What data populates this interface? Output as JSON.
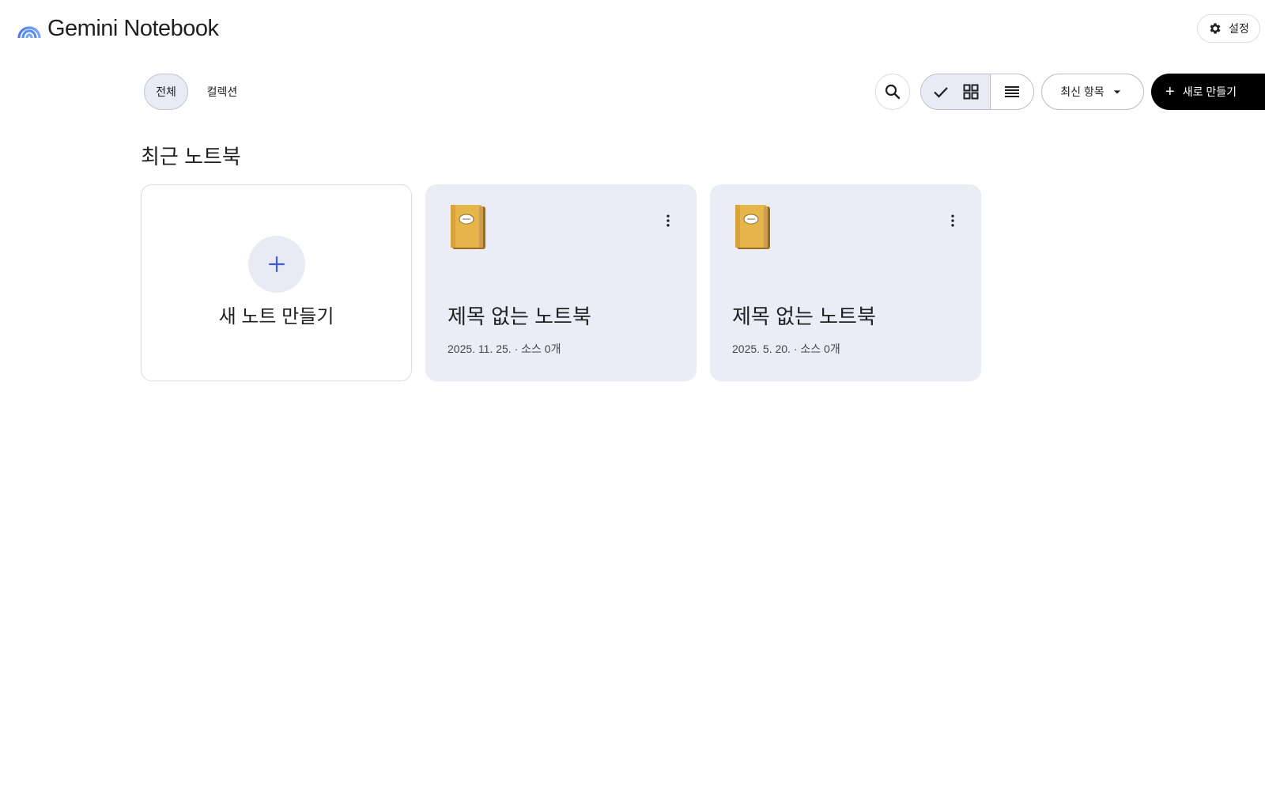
{
  "app": {
    "title": "Gemini Notebook",
    "settings_label": "설정"
  },
  "toolbar": {
    "filters": [
      "전체",
      "컬렉션"
    ],
    "active_filter": "전체",
    "view_mode": "grid",
    "sort_label": "최신 항목",
    "create_label": "새로 만들기"
  },
  "section": {
    "title": "최근 노트북"
  },
  "new_card": {
    "label": "새 노트 만들기"
  },
  "notebooks": [
    {
      "title": "제목 없는 노트북",
      "date": "2025. 11. 25.",
      "sources": "소스 0개",
      "meta": "2025. 11. 25. · 소스 0개",
      "icon": "notebook-emoji"
    },
    {
      "title": "제목 없는 노트북",
      "date": "2025. 5. 20.",
      "sources": "소스 0개",
      "meta": "2025. 5. 20. · 소스 0개",
      "icon": "notebook-emoji"
    }
  ],
  "colors": {
    "accent": "#3b5bdb",
    "card_bg": "#eaecf6",
    "chip_bg": "#e8ebf5",
    "primary_button": "#000000"
  }
}
